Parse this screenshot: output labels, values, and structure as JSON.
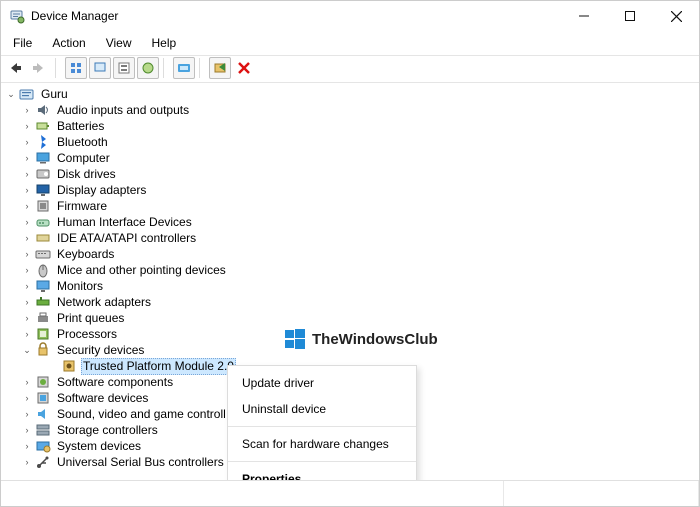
{
  "window": {
    "title": "Device Manager"
  },
  "menu": {
    "file": "File",
    "action": "Action",
    "view": "View",
    "help": "Help"
  },
  "toolbar": {
    "back": "back",
    "forward": "forward",
    "up": "up",
    "show_hidden": "show-hidden",
    "properties": "properties",
    "refresh": "refresh",
    "help": "help",
    "update_driver": "update-driver",
    "uninstall": "uninstall",
    "scan": "scan-hardware",
    "remove": "remove"
  },
  "tree": {
    "root": {
      "label": "Guru",
      "expanded": true
    },
    "items": [
      {
        "label": "Audio inputs and outputs",
        "icon": "audio"
      },
      {
        "label": "Batteries",
        "icon": "battery"
      },
      {
        "label": "Bluetooth",
        "icon": "bluetooth"
      },
      {
        "label": "Computer",
        "icon": "computer"
      },
      {
        "label": "Disk drives",
        "icon": "disk"
      },
      {
        "label": "Display adapters",
        "icon": "display"
      },
      {
        "label": "Firmware",
        "icon": "firmware"
      },
      {
        "label": "Human Interface Devices",
        "icon": "hid"
      },
      {
        "label": "IDE ATA/ATAPI controllers",
        "icon": "ide"
      },
      {
        "label": "Keyboards",
        "icon": "keyboard"
      },
      {
        "label": "Mice and other pointing devices",
        "icon": "mouse"
      },
      {
        "label": "Monitors",
        "icon": "monitor"
      },
      {
        "label": "Network adapters",
        "icon": "network"
      },
      {
        "label": "Print queues",
        "icon": "printer"
      },
      {
        "label": "Processors",
        "icon": "cpu"
      },
      {
        "label": "Security devices",
        "icon": "security",
        "expanded": true,
        "children": [
          {
            "label": "Trusted Platform Module 2.0",
            "icon": "tpm",
            "selected": true
          }
        ]
      },
      {
        "label": "Software components",
        "icon": "swcomp"
      },
      {
        "label": "Software devices",
        "icon": "swdev"
      },
      {
        "label": "Sound, video and game controll",
        "icon": "sound"
      },
      {
        "label": "Storage controllers",
        "icon": "storage"
      },
      {
        "label": "System devices",
        "icon": "system"
      },
      {
        "label": "Universal Serial Bus controllers",
        "icon": "usb"
      }
    ]
  },
  "context_menu": {
    "update": "Update driver",
    "uninstall": "Uninstall device",
    "scan": "Scan for hardware changes",
    "properties": "Properties"
  },
  "watermark": {
    "text": "TheWindowsClub"
  }
}
